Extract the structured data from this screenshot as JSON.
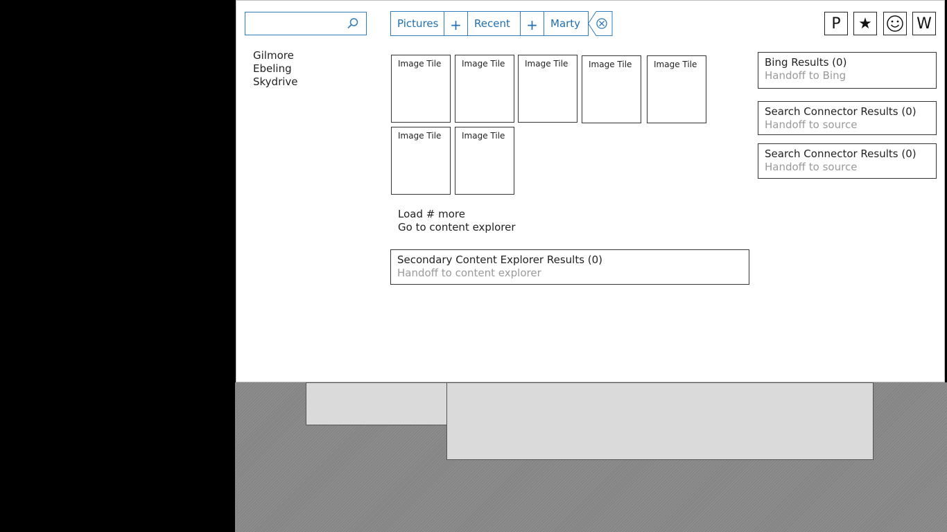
{
  "search": {
    "value": "",
    "placeholder": ""
  },
  "scopes": [
    "Gilmore",
    "Ebeling",
    "Skydrive"
  ],
  "pivots": [
    {
      "label": "Pictures"
    },
    {
      "label": "Recent"
    },
    {
      "label": "Marty"
    }
  ],
  "plus_label": "+",
  "app_buttons": [
    {
      "label": "P"
    },
    {
      "label": "★"
    },
    {
      "label": ""
    },
    {
      "label": "W"
    }
  ],
  "tiles": [
    "Image Tile",
    "Image Tile",
    "Image Tile",
    "Image Tile",
    "Image Tile",
    "Image Tile",
    "Image Tile"
  ],
  "links": {
    "load_more": "Load # more",
    "go_explorer": "Go to content explorer"
  },
  "secondary": {
    "title": "Secondary Content Explorer Results (0)",
    "handoff": "Handoff to content explorer"
  },
  "bing": {
    "title": "Bing Results (0)",
    "handoff": "Handoff to Bing"
  },
  "connectors": [
    {
      "title": "Search Connector Results (0)",
      "handoff": "Handoff to source"
    },
    {
      "title": "Search Connector Results (0)",
      "handoff": "Handoff to source"
    }
  ],
  "icons": {
    "search": "magnifier-icon",
    "clear": "clear-circle-x-icon",
    "smiley": "smiley-icon"
  },
  "colors": {
    "accent": "#2b7bbd",
    "muted_text": "#9a9a9a"
  }
}
